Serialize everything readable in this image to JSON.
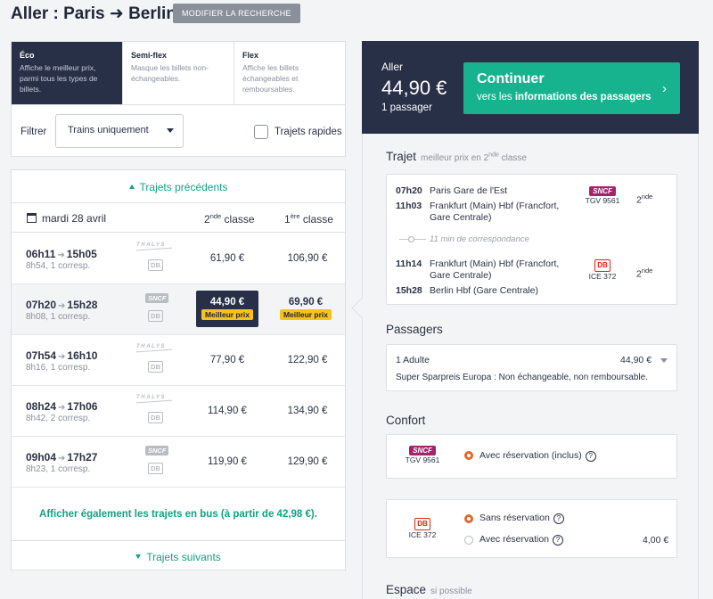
{
  "header": {
    "title": "Aller : Paris ➜ Berlin",
    "modify_label": "MODIFIER LA RECHERCHE"
  },
  "fare_tabs": [
    {
      "label": "Éco",
      "desc": "Affiche le meilleur prix, parmi tous les types de billets.",
      "active": true
    },
    {
      "label": "Semi-flex",
      "desc": "Masque les billets non-échangeables.",
      "active": false
    },
    {
      "label": "Flex",
      "desc": "Affiche les billets échangeables et remboursables.",
      "active": false
    }
  ],
  "filter": {
    "label": "Filtrer",
    "select_value": "Trains uniquement",
    "checkbox_label": "Trajets rapides",
    "checkbox_checked": false
  },
  "results": {
    "prev_label": "Trajets précédents",
    "date": "mardi 28 avril",
    "col_2nd_num": "2",
    "col_2nd_sup": "nde",
    "col_2nd_word": " classe",
    "col_1st_num": "1",
    "col_1st_sup": "ère",
    "col_1st_word": " classe",
    "rows": [
      {
        "dep": "06h11",
        "arr": "15h05",
        "info": "8h54, 1 corresp.",
        "ops": [
          "thalys",
          "db"
        ],
        "price2": "61,90 €",
        "price1": "106,90 €"
      },
      {
        "dep": "07h20",
        "arr": "15h28",
        "info": "8h08, 1 corresp.",
        "ops": [
          "sncf",
          "db"
        ],
        "price2": "44,90 €",
        "price1": "69,90 €",
        "selected": true,
        "badge": "Meilleur prix"
      },
      {
        "dep": "07h54",
        "arr": "16h10",
        "info": "8h16, 1 corresp.",
        "ops": [
          "thalys",
          "db"
        ],
        "price2": "77,90 €",
        "price1": "122,90 €"
      },
      {
        "dep": "08h24",
        "arr": "17h06",
        "info": "8h42, 2 corresp.",
        "ops": [
          "thalys",
          "db"
        ],
        "price2": "114,90 €",
        "price1": "134,90 €"
      },
      {
        "dep": "09h04",
        "arr": "17h27",
        "info": "8h23, 1 corresp.",
        "ops": [
          "sncf",
          "db"
        ],
        "price2": "119,90 €",
        "price1": "129,90 €"
      }
    ],
    "bus_label": "Afficher également les trajets en bus (à partir de 42,98 €).",
    "next_label": "Trajets suivants"
  },
  "operator_labels": {
    "thalys": "THALYS",
    "sncf": "SNCF",
    "db": "DB"
  },
  "summary": {
    "direction": "Aller",
    "price": "44,90 €",
    "passengers": "1 passager",
    "cta_main": "Continuer",
    "cta_sub_prefix": "vers les ",
    "cta_sub_bold": "informations des passagers",
    "cta_chevron": "›"
  },
  "trip": {
    "title": "Trajet",
    "subtitle_prefix": "meilleur prix en 2",
    "subtitle_sup": "nde",
    "subtitle_suffix": " classe",
    "legs": [
      {
        "time1": "07h20",
        "stn1": "Paris Gare de l'Est",
        "time2": "11h03",
        "stn2": "Frankfurt (Main) Hbf (Francfort, Gare Centrale)",
        "op_logo": "SNCF",
        "op_name": "TGV 9561",
        "class_num": "2",
        "class_sup": "nde"
      },
      {
        "time1": "11h14",
        "stn1": "Frankfurt (Main) Hbf (Francfort, Gare Centrale)",
        "time2": "15h28",
        "stn2": "Berlin Hbf (Gare Centrale)",
        "op_logo": "DB",
        "op_name": "ICE 372",
        "class_num": "2",
        "class_sup": "nde"
      }
    ],
    "connection": "11 min de correspondance"
  },
  "passengers": {
    "title": "Passagers",
    "name": "1 Adulte",
    "price": "44,90 €",
    "desc": "Super Sparpreis Europa : Non échangeable, non remboursable."
  },
  "comfort": {
    "title": "Confort",
    "tgv": {
      "logo": "SNCF",
      "name": "TGV 9561",
      "option": "Avec réservation (inclus)",
      "qmark": "?"
    },
    "ice": {
      "logo": "DB",
      "name": "ICE 372",
      "opt1": "Sans réservation",
      "opt2": "Avec réservation",
      "opt2_price": "4,00 €",
      "qmark": "?"
    }
  },
  "space": {
    "title": "Espace",
    "subtitle": "si possible"
  }
}
